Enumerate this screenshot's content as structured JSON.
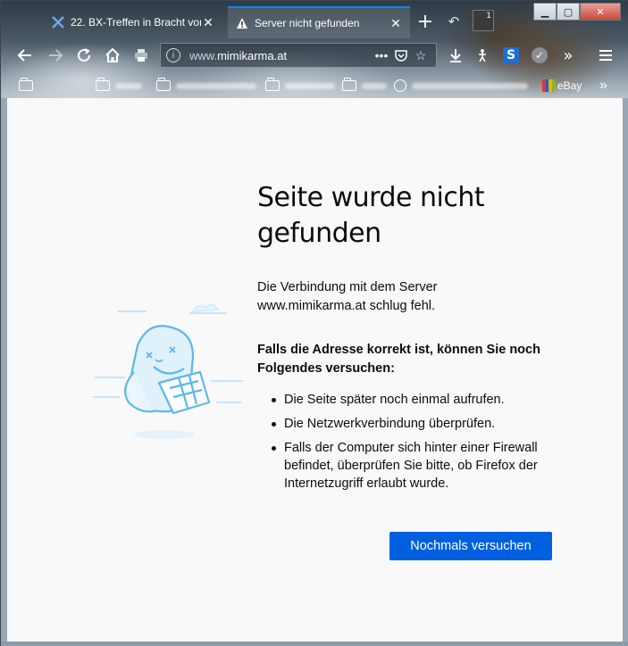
{
  "tabs": [
    {
      "title": "22. BX-Treffen in Bracht vom",
      "favicon": "bx-logo-icon",
      "active": false
    },
    {
      "title": "Server nicht gefunden",
      "favicon": "warning-icon",
      "active": true
    }
  ],
  "tab_count_badge": "1",
  "url": {
    "prefix": "www.",
    "host": "mimikarma.at"
  },
  "bookmarks": {
    "ebay_label": "eBay"
  },
  "error_page": {
    "title_line1": "Seite wurde nicht",
    "title_line2": "gefunden",
    "description_line1": "Die Verbindung mit dem Server",
    "description_line2": "www.mimikarma.at schlug fehl.",
    "suggestions_heading_line1": "Falls die Adresse korrekt ist, können Sie noch",
    "suggestions_heading_line2": "Folgendes versuchen:",
    "suggestions": [
      {
        "line1": "Die Seite später noch einmal aufrufen.",
        "line2": "",
        "line3": ""
      },
      {
        "line1": "Die Netzwerkverbindung überprüfen.",
        "line2": "",
        "line3": ""
      },
      {
        "line1": "Falls der Computer sich hinter einer Firewall",
        "line2": "befindet, überprüfen Sie bitte, ob Firefox der",
        "line3": "Internetzugriff erlaubt wurde."
      }
    ],
    "retry_label": "Nochmals versuchen"
  },
  "colors": {
    "accent": "#0060df",
    "page_bg": "#f9f9fa",
    "illustration": "#5bb8ec"
  }
}
